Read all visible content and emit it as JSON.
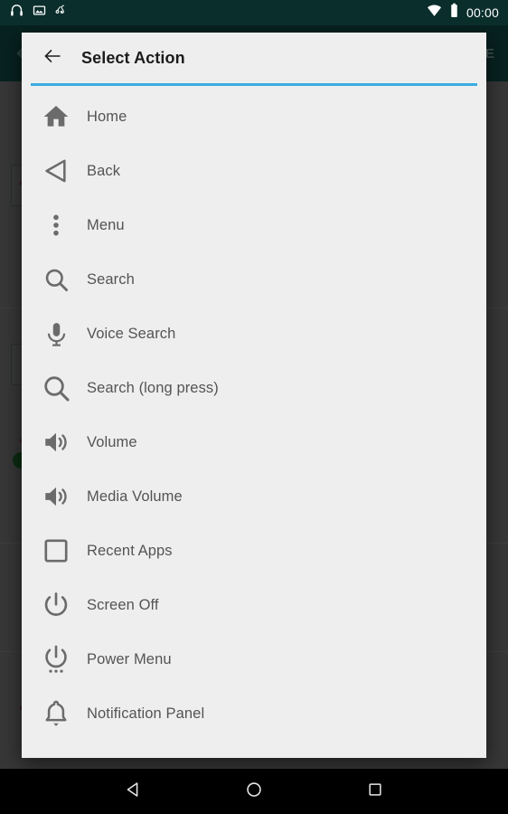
{
  "status_bar": {
    "background_color": "#0a2e2c",
    "left_icons": [
      {
        "name": "headphones-icon",
        "label": "Headphones connected"
      },
      {
        "name": "screenshot-image-icon",
        "label": "Screenshot captured"
      },
      {
        "name": "gesture-pen-icon",
        "label": "Gesture"
      }
    ],
    "right_icons": [
      {
        "name": "wifi-icon",
        "label": "Wi-Fi"
      },
      {
        "name": "battery-icon",
        "label": "Battery"
      }
    ],
    "clock": "00:00"
  },
  "background_app": {
    "toolbar_background": "#0c3735",
    "back_icon": "arrow-left-icon",
    "save_label": "AVE"
  },
  "dialog": {
    "background_color": "#eeeeee",
    "accent_color": "#3aade2",
    "back_icon": "arrow-left-icon",
    "title": "Select Action",
    "items": [
      {
        "icon": "home-icon",
        "label": "Home"
      },
      {
        "icon": "back-triangle-icon",
        "label": "Back"
      },
      {
        "icon": "overflow-menu-icon",
        "label": "Menu"
      },
      {
        "icon": "search-icon",
        "label": "Search"
      },
      {
        "icon": "microphone-icon",
        "label": "Voice Search"
      },
      {
        "icon": "search-large-icon",
        "label": "Search (long press)"
      },
      {
        "icon": "volume-icon",
        "label": "Volume"
      },
      {
        "icon": "media-volume-icon",
        "label": "Media Volume"
      },
      {
        "icon": "recent-apps-square-icon",
        "label": "Recent Apps"
      },
      {
        "icon": "power-icon",
        "label": "Screen Off"
      },
      {
        "icon": "power-menu-icon",
        "label": "Power Menu"
      },
      {
        "icon": "bell-icon",
        "label": "Notification Panel"
      }
    ]
  },
  "nav_bar": {
    "background_color": "#000000",
    "buttons": [
      {
        "name": "nav-back-button",
        "icon": "triangle-left-icon"
      },
      {
        "name": "nav-home-button",
        "icon": "circle-icon"
      },
      {
        "name": "nav-recents-button",
        "icon": "square-icon"
      }
    ]
  }
}
